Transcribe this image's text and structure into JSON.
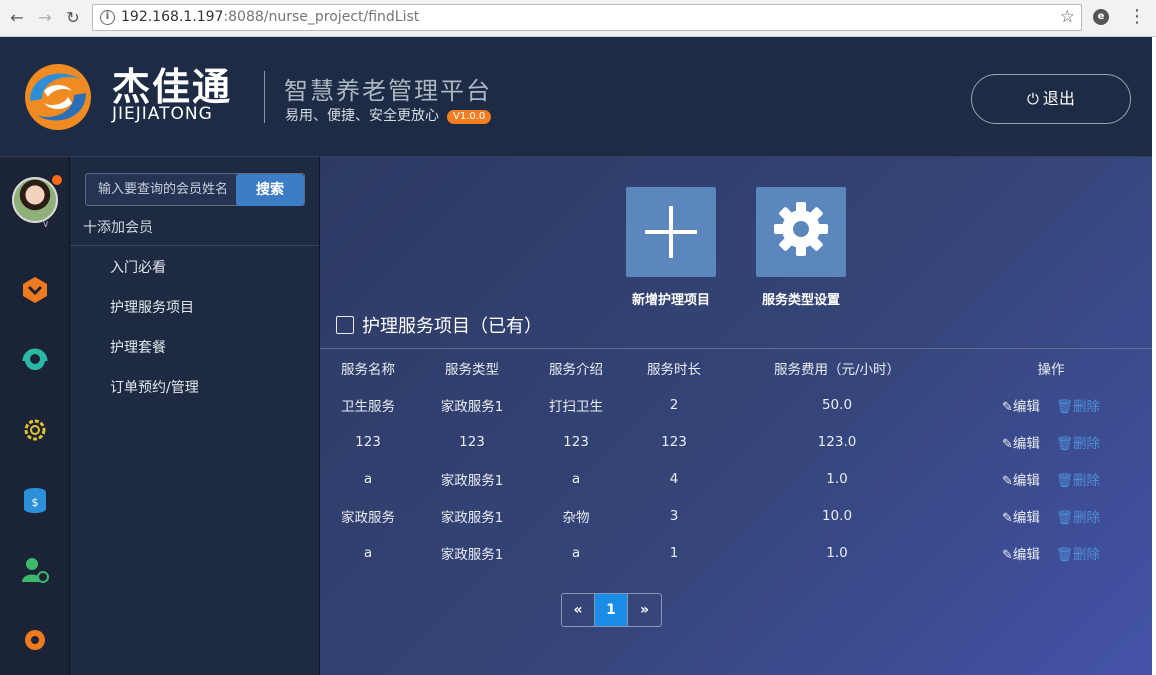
{
  "browser": {
    "url_host": "192.168.1.197",
    "url_rest": ":8088/nurse_project/findList"
  },
  "header": {
    "brand_cn": "杰佳通",
    "brand_en": "JIEJIATONG",
    "title": "智慧养老管理平台",
    "subtitle": "易用、便捷、安全更放心",
    "version": "V1.0.0",
    "logout_label": "退出"
  },
  "sidebar": {
    "search_placeholder": "输入要查询的会员姓名",
    "search_button": "搜索",
    "add_member": "十添加会员",
    "items": [
      "入门必看",
      "护理服务项目",
      "护理套餐",
      "订单预约/管理"
    ]
  },
  "main": {
    "tiles": [
      {
        "label": "新增护理项目",
        "icon": "plus-icon"
      },
      {
        "label": "服务类型设置",
        "icon": "gear-icon"
      }
    ],
    "section_title": "护理服务项目（已有）",
    "table": {
      "headers": [
        "服务名称",
        "服务类型",
        "服务介绍",
        "服务时长",
        "服务费用（元/小时）",
        "操作"
      ],
      "rows": [
        [
          "卫生服务",
          "家政服务1",
          "打扫卫生",
          "2",
          "50.0"
        ],
        [
          "123",
          "123",
          "123",
          "123",
          "123.0"
        ],
        [
          "a",
          "家政服务1",
          "a",
          "4",
          "1.0"
        ],
        [
          "家政服务",
          "家政服务1",
          "杂物",
          "3",
          "10.0"
        ],
        [
          "a",
          "家政服务1",
          "a",
          "1",
          "1.0"
        ]
      ],
      "edit_label": "编辑",
      "delete_label": "删除"
    },
    "pager": {
      "prev": "«",
      "current": "1",
      "next": "»"
    }
  },
  "colors": {
    "header_bg": "#1d2b44",
    "accent_blue": "#3d7dc5",
    "active_page": "#1c8de6",
    "version_badge": "#f47d20"
  }
}
